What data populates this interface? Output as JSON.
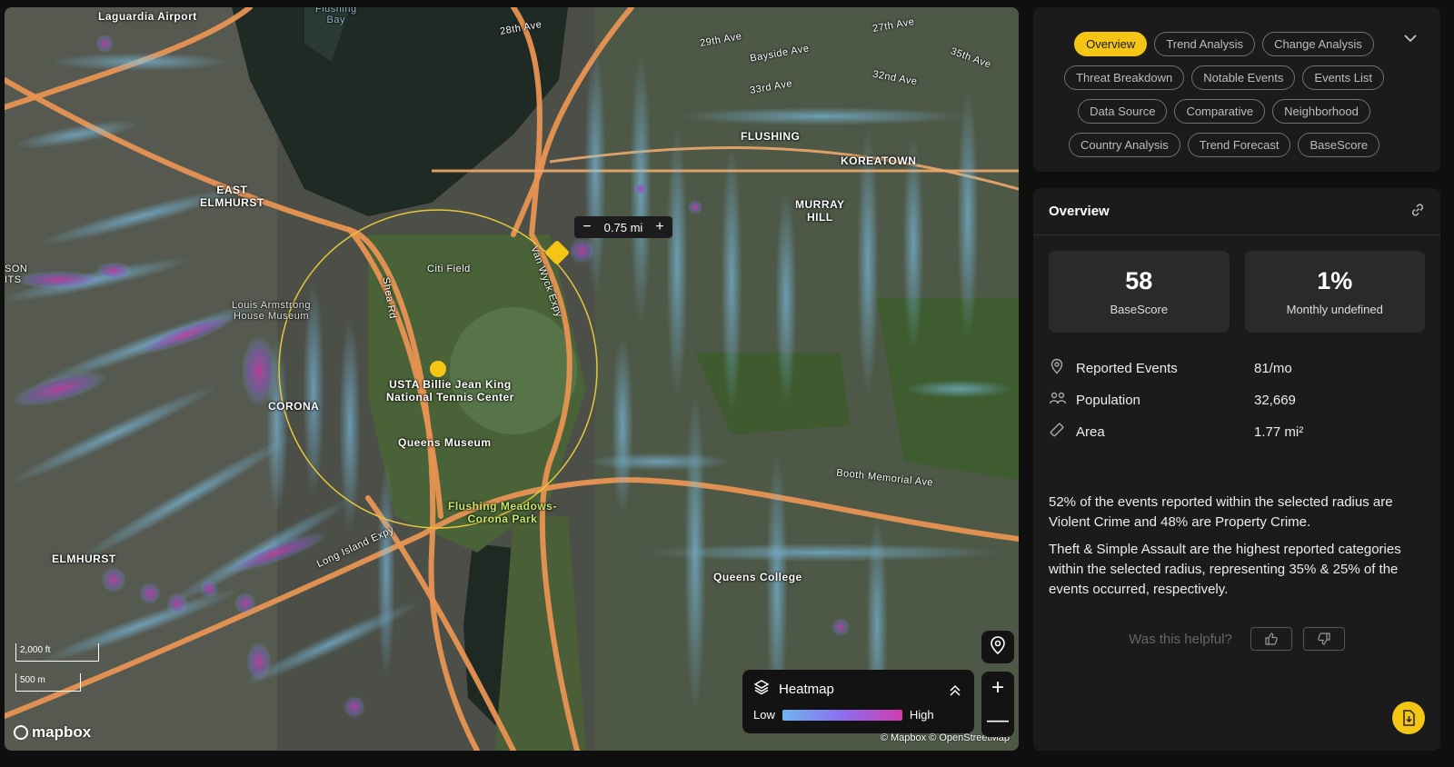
{
  "map": {
    "labels": {
      "laguardia": "Laguardia Airport",
      "flushing_bay": "Flushing\nBay",
      "east_elmhurst": "EAST\nELMHURST",
      "citi_field": "Citi Field",
      "louis_armstrong": "Louis Armstrong\nHouse Museum",
      "corona": "CORONA",
      "usta": "USTA Billie Jean King\nNational Tennis Center",
      "queens_museum": "Queens Museum",
      "flushing_meadows": "Flushing Meadows-\nCorona Park",
      "elmhurst": "ELMHURST",
      "flushing": "FLUSHING",
      "koreatown": "KOREATOWN",
      "murray_hill": "MURRAY\nHILL",
      "queens_college": "Queens College",
      "booth_memorial": "Booth Memorial Ave",
      "bayside_ave": "Bayside Ave",
      "ave_32nd": "32nd Ave",
      "ave_29th": "29th Ave",
      "ave_28th": "28th Ave",
      "ave_27th": "27th Ave",
      "ave_33rd": "33rd Ave",
      "ave_35th": "35th Ave",
      "long_island_expy": "Long Island Expy",
      "van_wyck_expy": "Van Wyck Expy",
      "shea_rd": "Shea Rd",
      "son_its": "SON\nITS"
    },
    "radius": {
      "value": "0.75 mi",
      "minus": "−",
      "plus": "+"
    },
    "legend": {
      "title": "Heatmap",
      "low": "Low",
      "high": "High"
    },
    "scale": {
      "large": "2,000 ft",
      "small": "500 m"
    },
    "logo": "mapbox",
    "attribution": "© Mapbox © OpenStreetMap",
    "icons": {
      "layers": "layers-icon",
      "location": "location-pin-icon",
      "zoom_in": "plus-icon",
      "zoom_out": "minus-icon"
    }
  },
  "tabs": [
    {
      "label": "Overview",
      "active": true
    },
    {
      "label": "Trend Analysis"
    },
    {
      "label": "Change Analysis"
    },
    {
      "label": "Threat Breakdown"
    },
    {
      "label": "Notable Events"
    },
    {
      "label": "Events List"
    },
    {
      "label": "Data Source"
    },
    {
      "label": "Comparative"
    },
    {
      "label": "Neighborhood"
    },
    {
      "label": "Country Analysis"
    },
    {
      "label": "Trend Forecast"
    },
    {
      "label": "BaseScore"
    }
  ],
  "overview": {
    "title": "Overview",
    "stats": [
      {
        "value": "58",
        "label": "BaseScore"
      },
      {
        "value": "1%",
        "label": "Monthly undefined"
      }
    ],
    "metrics": [
      {
        "icon": "pin-icon",
        "label": "Reported Events",
        "value": "81/mo"
      },
      {
        "icon": "people-icon",
        "label": "Population",
        "value": "32,669"
      },
      {
        "icon": "ruler-icon",
        "label": "Area",
        "value": "1.77 mi²"
      }
    ],
    "summary": [
      "52% of the events reported within the selected radius are Violent Crime and 48% are Property Crime.",
      "Theft & Simple Assault are the highest reported categories within the selected radius, representing 35% & 25% of the events occurred, respectively."
    ],
    "feedback": {
      "question": "Was this helpful?"
    }
  },
  "colors": {
    "accent": "#f4c514",
    "panel": "#1b1b1d",
    "heat_low": "#6fb4ee",
    "heat_high": "#d13bb0"
  }
}
